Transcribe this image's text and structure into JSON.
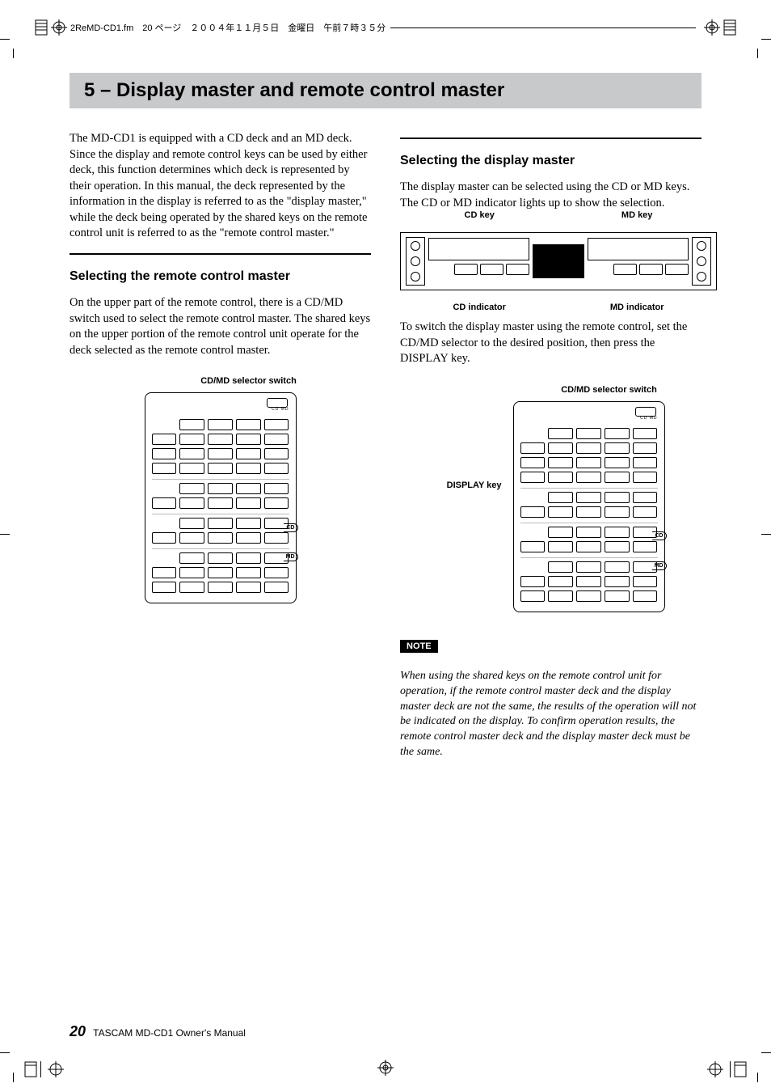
{
  "header": {
    "meta": "2ReMD-CD1.fm　20 ページ　２００４年１１月５日　金曜日　午前７時３５分"
  },
  "chapter": {
    "title": "5 – Display master and remote control master"
  },
  "left": {
    "intro": "The MD-CD1 is equipped with a CD deck and an MD deck. Since the display and remote control keys can be used by either deck, this function determines which deck is represented by their operation. In this manual, the deck represented by the information in the display is referred to as the \"display master,\" while the deck being operated by the shared keys on the remote control unit is referred to as the \"remote control master.\"",
    "h2": "Selecting the remote control master",
    "p1": "On the upper part of the remote control, there is a CD/MD switch used to select the remote control master. The shared keys on the upper portion of the remote control unit operate for the deck selected as the remote control master.",
    "fig_label": "CD/MD selector switch",
    "cdmd": "CD   MD"
  },
  "right": {
    "h2": "Selecting the display master",
    "p1": "The display master can be selected using the CD or MD keys. The CD or MD indicator lights up to show the selection.",
    "deck": {
      "cdkey": "CD key",
      "mdkey": "MD key",
      "cdind": "CD indicator",
      "mdind": "MD indicator"
    },
    "p2": "To switch the display master using the remote control, set the CD/MD selector to the desired position, then press the DISPLAY key.",
    "fig2a": "CD/MD selector switch",
    "fig2b": "DISPLAY key",
    "cd_badge": "CD",
    "md_badge": "MD",
    "note_badge": "NOTE",
    "note": "When using the shared keys on the remote control unit for operation, if the remote control master deck and the display master deck are not the same, the results of the operation will not be indicated on the display. To confirm operation results, the remote control master deck and the display master deck must be the same."
  },
  "footer": {
    "page": "20",
    "doc": "TASCAM MD-CD1 Owner's Manual"
  }
}
